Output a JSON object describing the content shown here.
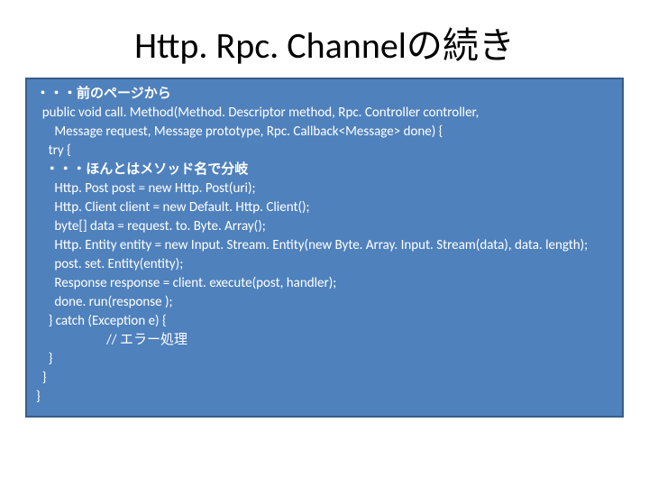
{
  "title": "Http. Rpc. Channelの続き",
  "code": {
    "l1": "・・・前のページから",
    "l2": "  public void call. Method(Method. Descriptor method, Rpc. Controller controller,",
    "l3": "      Message request, Message prototype, Rpc. Callback<Message> done) {",
    "l4": "    try {",
    "l5": "   ・・・ほんとはメソッド名で分岐",
    "l6": "      Http. Post post = new Http. Post(uri);",
    "l7": "      Http. Client client = new Default. Http. Client();",
    "l8": "      byte[] data = request. to. Byte. Array();",
    "l9": "      Http. Entity entity = new Input. Stream. Entity(new Byte. Array. Input. Stream(data), data. length);",
    "l10": "      post. set. Entity(entity);",
    "l11": "      Response response = client. execute(post, handler);",
    "l12": "      done. run(response );",
    "l13": "    } catch (Exception e) {",
    "l14": "                       // エラー処理",
    "l15": "    }",
    "l16": "  }",
    "l17": "}"
  }
}
